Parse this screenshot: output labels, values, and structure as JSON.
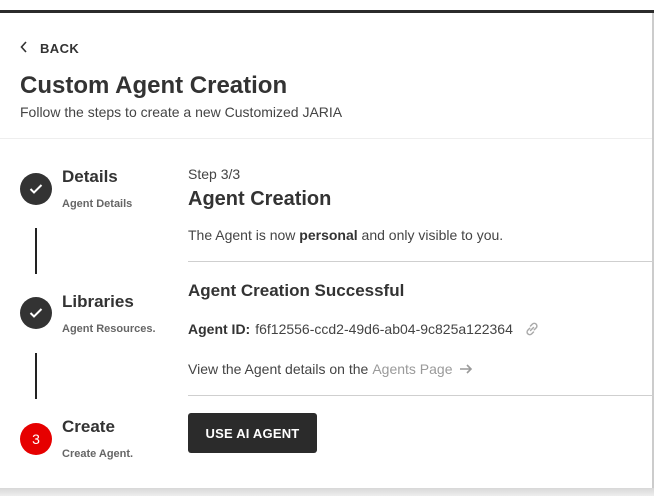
{
  "header": {
    "back_label": "BACK",
    "title": "Custom Agent Creation",
    "subtitle": "Follow the steps to create a new Customized JARIA"
  },
  "stepper": {
    "steps": [
      {
        "title": "Details",
        "subtitle": "Agent Details",
        "status": "done",
        "icon": "check-icon"
      },
      {
        "title": "Libraries",
        "subtitle": "Agent Resources.",
        "status": "done",
        "icon": "check-icon"
      },
      {
        "title": "Create",
        "subtitle": "Create Agent.",
        "status": "active",
        "number": "3"
      }
    ]
  },
  "content": {
    "step_count": "Step 3/3",
    "title": "Agent Creation",
    "visibility_prefix": "The Agent is now ",
    "visibility_bold": "personal",
    "visibility_suffix": " and only visible to you.",
    "success_title": "Agent Creation Successful",
    "agent_id_label": "Agent ID:",
    "agent_id_value": "f6f12556-ccd2-49d6-ab04-9c825a122364",
    "view_prefix": "View the Agent details on the",
    "agents_page_link": "Agents Page",
    "use_button": "USE AI AGENT"
  },
  "colors": {
    "dark": "#2b2b2b",
    "active_step": "#e60000",
    "link_gray": "#9a9a9a"
  }
}
